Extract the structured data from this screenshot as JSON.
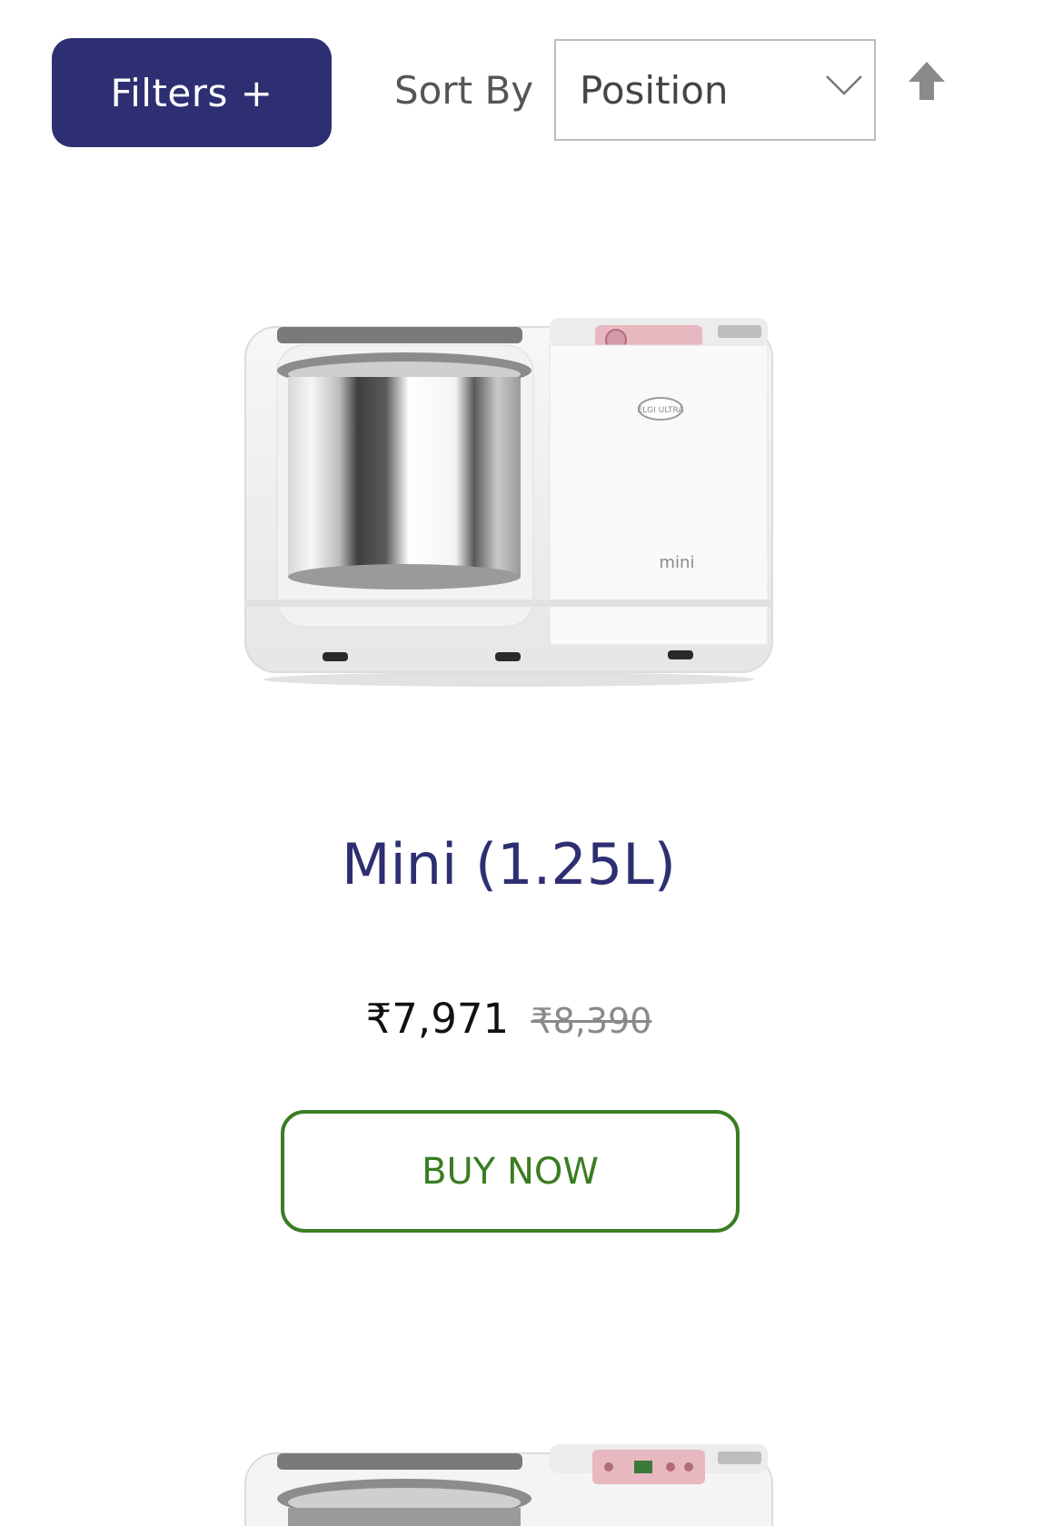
{
  "toolbar": {
    "filters_label": "Filters +",
    "sort_label": "Sort By",
    "sort_value": "Position"
  },
  "product": {
    "name": "Mini (1.25L)",
    "price": "₹7,971",
    "old_price": "₹8,390",
    "buy_label": "BUY NOW",
    "image_text": "mini",
    "brand_badge": "ELGI ULTRA"
  },
  "colors": {
    "brand": "#2e2f72",
    "buy": "#3a7d22"
  },
  "icons": {
    "sort_direction": "arrow-up-icon",
    "dropdown": "chevron-down-icon"
  }
}
